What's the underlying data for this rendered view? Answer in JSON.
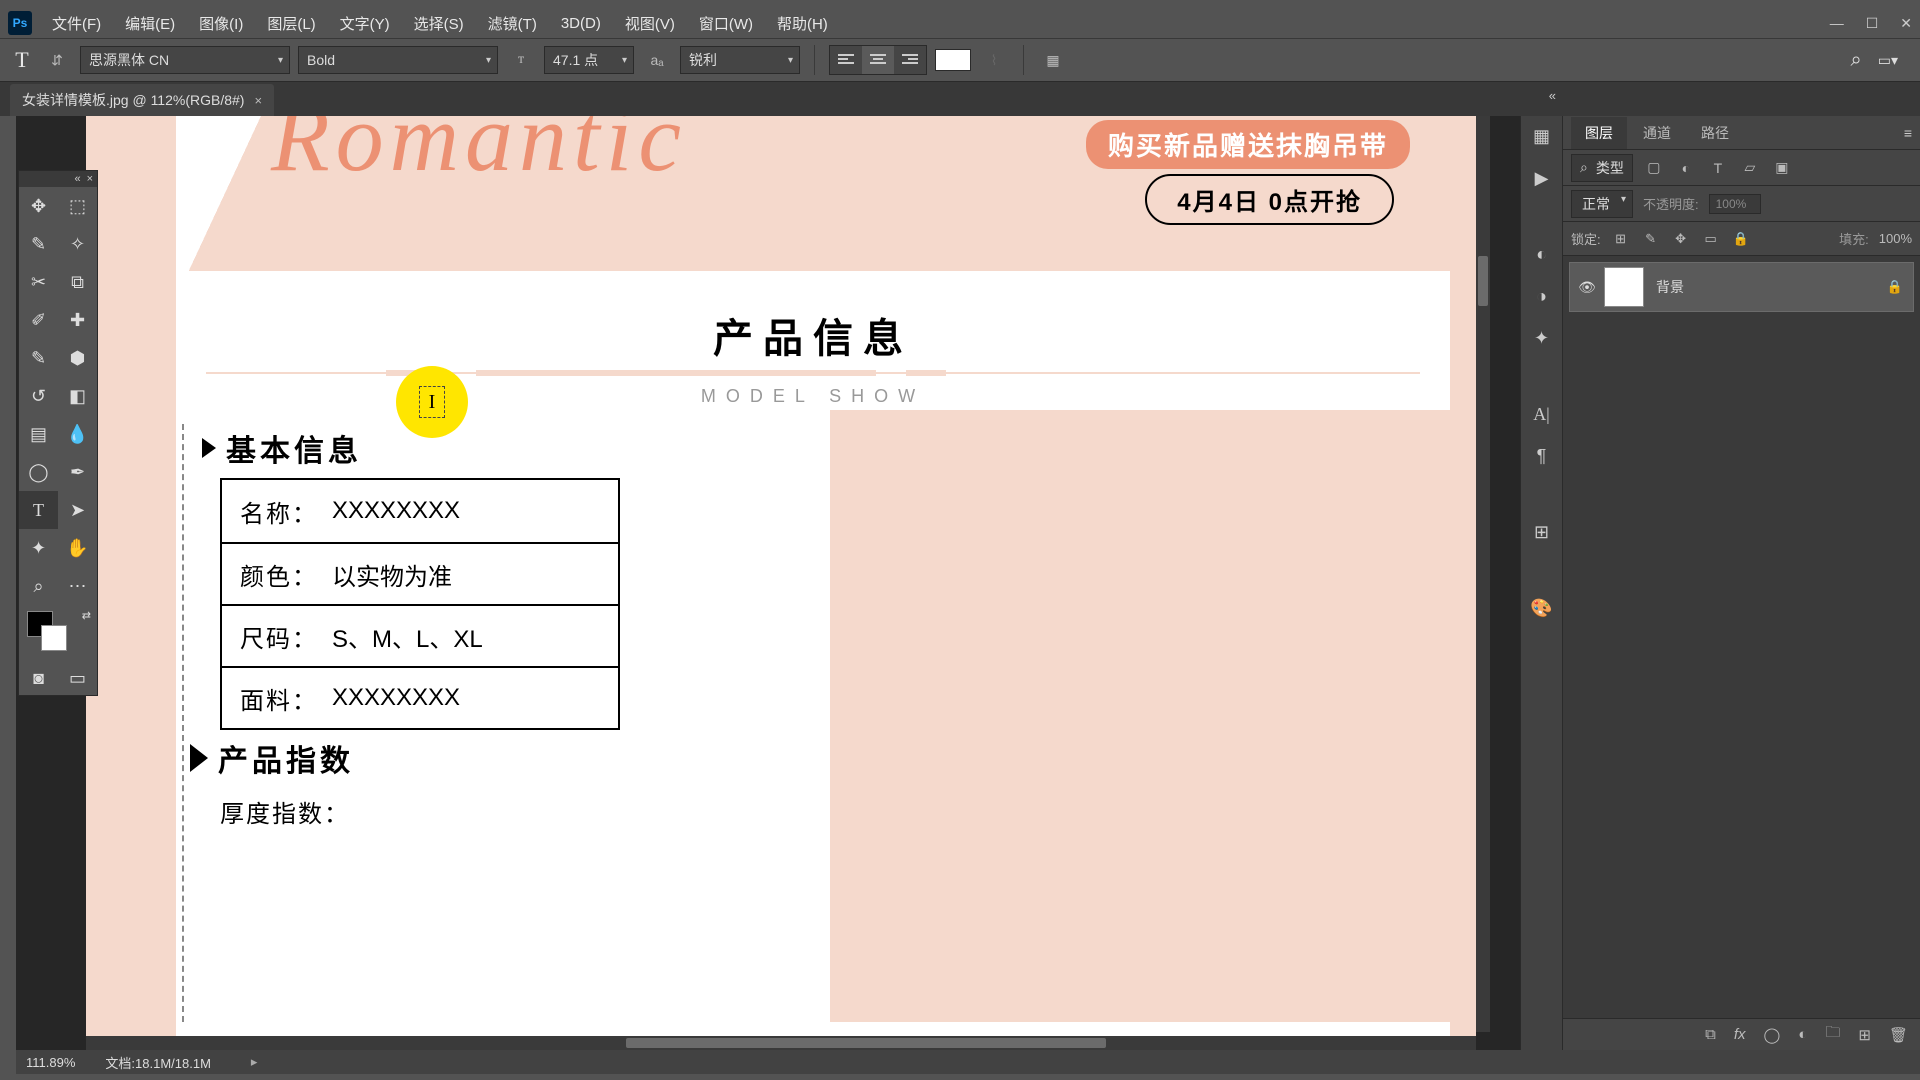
{
  "menubar": {
    "items": [
      "文件(F)",
      "编辑(E)",
      "图像(I)",
      "图层(L)",
      "文字(Y)",
      "选择(S)",
      "滤镜(T)",
      "3D(D)",
      "视图(V)",
      "窗口(W)",
      "帮助(H)"
    ]
  },
  "optbar": {
    "font": "思源黑体 CN",
    "weight": "Bold",
    "size": "47.1 点",
    "aa": "锐利"
  },
  "doc": {
    "tab": "女装详情模板.jpg @ 112%(RGB/8#)"
  },
  "canvas": {
    "romantic": "Romantic",
    "pill": "购买新品赠送抹胸吊带",
    "date": "4月4日 0点开抢",
    "sec_cn": "产品信息",
    "sec_en": "MODEL SHOW",
    "basic": "基本信息",
    "rows": [
      {
        "lab": "名称：",
        "val": "XXXXXXXX"
      },
      {
        "lab": "颜色：",
        "val": "以实物为准"
      },
      {
        "lab": "尺码：",
        "val": "S、M、L、XL"
      },
      {
        "lab": "面料：",
        "val": "XXXXXXXX"
      }
    ],
    "prod": "产品指数",
    "thk": "厚度指数："
  },
  "layers": {
    "tabs": [
      "图层",
      "通道",
      "路径"
    ],
    "kind_label": "类型",
    "blend": "正常",
    "opacity_lab": "不透明度:",
    "opacity_val": "100%",
    "lock_lab": "锁定:",
    "fill_lab": "填充:",
    "fill_val": "100%",
    "layer_name": "背景"
  },
  "status": {
    "zoom": "111.89%",
    "doc": "文档:18.1M/18.1M"
  }
}
